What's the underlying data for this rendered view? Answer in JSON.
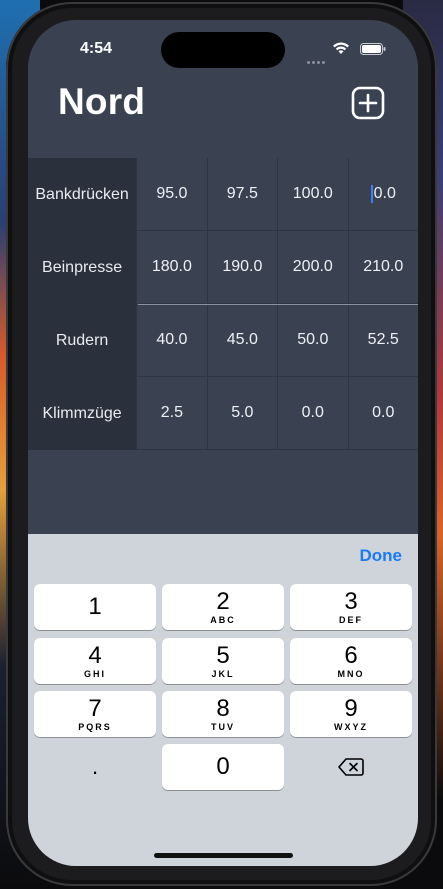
{
  "status": {
    "time": "4:54"
  },
  "header": {
    "title": "Nord"
  },
  "table": {
    "rows": [
      {
        "label": "Bankdrücken",
        "values": [
          "95.0",
          "97.5",
          "100.0",
          "0.0"
        ]
      },
      {
        "label": "Beinpresse",
        "values": [
          "180.0",
          "190.0",
          "200.0",
          "210.0"
        ]
      },
      {
        "label": "Rudern",
        "values": [
          "40.0",
          "45.0",
          "50.0",
          "52.5"
        ]
      },
      {
        "label": "Klimmzüge",
        "values": [
          "2.5",
          "5.0",
          "0.0",
          "0.0"
        ]
      }
    ]
  },
  "keyboard": {
    "done_label": "Done",
    "keys": [
      {
        "num": "1",
        "letters": ""
      },
      {
        "num": "2",
        "letters": "ABC"
      },
      {
        "num": "3",
        "letters": "DEF"
      },
      {
        "num": "4",
        "letters": "GHI"
      },
      {
        "num": "5",
        "letters": "JKL"
      },
      {
        "num": "6",
        "letters": "MNO"
      },
      {
        "num": "7",
        "letters": "PQRS"
      },
      {
        "num": "8",
        "letters": "TUV"
      },
      {
        "num": "9",
        "letters": "WXYZ"
      },
      {
        "num": "0",
        "letters": ""
      }
    ],
    "decimal_label": "."
  },
  "colors": {
    "accent": "#1a7cf0",
    "background": "#3a4252",
    "label_column": "#2a313c"
  }
}
